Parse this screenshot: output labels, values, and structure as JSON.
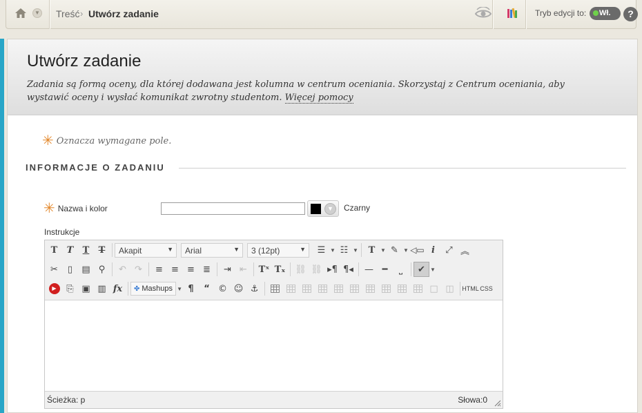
{
  "topbar": {
    "breadcrumb_parent": "Treść",
    "breadcrumb_separator": "›",
    "breadcrumb_current": "Utwórz zadanie",
    "edit_mode_label": "Tryb edycji to:",
    "edit_mode_value": "Wł.",
    "help_label": "?"
  },
  "header": {
    "title": "Utwórz zadanie",
    "description": "Zadania są formą oceny, dla której dodawana jest kolumna w centrum oceniania. Skorzystaj z Centrum oceniania, aby wystawić oceny i wysłać komunikat zwrotny studentom.",
    "more_help": "Więcej pomocy"
  },
  "form": {
    "required_note": "Oznacza wymagane pole.",
    "required_star": "✳",
    "section_title": "INFORMACJE O ZADANIU",
    "name_label": "Nazwa i kolor",
    "name_value": "",
    "color_name": "Czarny",
    "color_value": "#000000",
    "instructions_label": "Instrukcje"
  },
  "editor": {
    "paragraph_select": "Akapit",
    "font_select": "Arial",
    "size_select": "3 (12pt)",
    "mashups_label": "Mashups",
    "html_button": "HTML",
    "css_button": "CSS",
    "path_label": "Ścieżka: p",
    "words_label": "Słowa:0"
  },
  "colors": {
    "accent": "#29a6c7",
    "required_star": "#e3892e",
    "toggle_on": "#6fd14a"
  }
}
